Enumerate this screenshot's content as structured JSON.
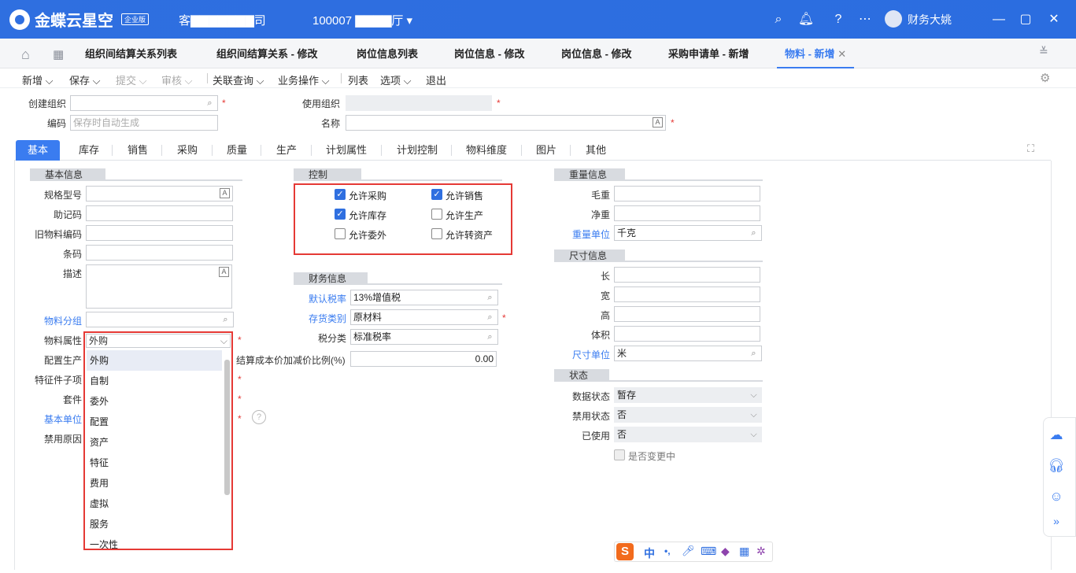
{
  "app": {
    "brand": "金蝶云星空",
    "edition": "企业版",
    "tenant": "客▇▇▇▇▇▇▇司",
    "org": "100007 ▇▇▇▇厅",
    "user": "财务大姚"
  },
  "tabs": [
    "组织间结算关系列表",
    "组织间结算关系 - 修改",
    "岗位信息列表",
    "岗位信息 - 修改",
    "岗位信息 - 修改",
    "采购申请单 - 新增",
    "物料 - 新增"
  ],
  "toolbar": [
    "新增",
    "保存",
    "提交",
    "审核",
    "关联查询",
    "业务操作",
    "列表",
    "选项",
    "退出"
  ],
  "header": {
    "create_org_label": "创建组织",
    "use_org_label": "使用组织",
    "code_label": "编码",
    "code_placeholder": "保存时自动生成",
    "name_label": "名称"
  },
  "form_tabs": [
    "基本",
    "库存",
    "销售",
    "采购",
    "质量",
    "生产",
    "计划属性",
    "计划控制",
    "物料维度",
    "图片",
    "其他"
  ],
  "basic": {
    "title": "基本信息",
    "spec": "规格型号",
    "mnemonic": "助记码",
    "old_code": "旧物料编码",
    "barcode": "条码",
    "desc": "描述",
    "group": "物料分组",
    "attr": "物料属性",
    "attr_value": "外购",
    "config": "配置生产",
    "feature": "特征件子项",
    "kit": "套件",
    "base_unit": "基本单位",
    "disable_reason": "禁用原因"
  },
  "attr_options": [
    "外购",
    "自制",
    "委外",
    "配置",
    "资产",
    "特征",
    "费用",
    "虚拟",
    "服务",
    "一次性"
  ],
  "control": {
    "title": "控制",
    "items": [
      {
        "label": "允许采购",
        "checked": true
      },
      {
        "label": "允许销售",
        "checked": true
      },
      {
        "label": "允许库存",
        "checked": true
      },
      {
        "label": "允许生产",
        "checked": false
      },
      {
        "label": "允许委外",
        "checked": false
      },
      {
        "label": "允许转资产",
        "checked": false
      }
    ]
  },
  "finance": {
    "title": "财务信息",
    "tax_rate_label": "默认税率",
    "tax_rate": "13%增值税",
    "stock_cat_label": "存货类别",
    "stock_cat": "原材料",
    "tax_class_label": "税分类",
    "tax_class": "标准税率",
    "ratio_label": "结算成本价加减价比例(%)",
    "ratio": "0.00"
  },
  "weight": {
    "title": "重量信息",
    "gross": "毛重",
    "net": "净重",
    "unit_label": "重量单位",
    "unit": "千克"
  },
  "size": {
    "title": "尺寸信息",
    "length": "长",
    "width": "宽",
    "height": "高",
    "volume": "体积",
    "unit_label": "尺寸单位",
    "unit": "米"
  },
  "status": {
    "title": "状态",
    "data_label": "数据状态",
    "data": "暂存",
    "forbid_label": "禁用状态",
    "forbid": "否",
    "used_label": "已使用",
    "used": "否",
    "changing": "是否变更中"
  },
  "ime": [
    "中",
    "•,",
    "🎤",
    "⌨"
  ]
}
